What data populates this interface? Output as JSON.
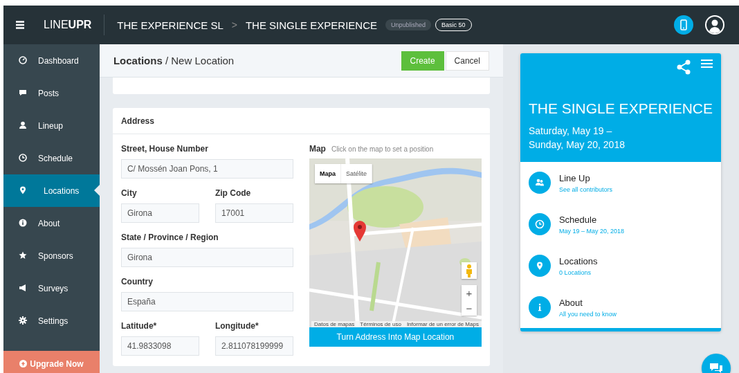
{
  "topbar": {
    "logo_light": "LINE",
    "logo_bold": "UPR",
    "breadcrumb": [
      "THE EXPERIENCE SL",
      "THE SINGLE EXPERIENCE"
    ],
    "separator": ">",
    "badges": [
      {
        "label": "Unpublished",
        "kind": "status"
      },
      {
        "label": "Basic 50",
        "kind": "plan"
      }
    ]
  },
  "sidebar": {
    "items": [
      {
        "label": "Dashboard",
        "selected": false
      },
      {
        "label": "Posts",
        "selected": false
      },
      {
        "label": "Lineup",
        "selected": false
      },
      {
        "label": "Schedule",
        "selected": false
      },
      {
        "label": "Locations",
        "selected": true
      },
      {
        "label": "About",
        "selected": false
      },
      {
        "label": "Sponsors",
        "selected": false
      },
      {
        "label": "Surveys",
        "selected": false
      },
      {
        "label": "Settings",
        "selected": false
      }
    ],
    "upgrade": "Upgrade Now"
  },
  "header": {
    "section": "Locations",
    "separator": "/",
    "page": "New Location",
    "buttons": [
      {
        "label": "Create",
        "kind": "primary"
      },
      {
        "label": "Cancel",
        "kind": "default"
      }
    ]
  },
  "address": {
    "title": "Address",
    "fields": [
      {
        "label": "Street, House Number",
        "value": "C/ Mossén Joan Pons, 1",
        "kind": "wide"
      },
      {
        "label": "City",
        "value": "Girona",
        "kind": "narrow"
      },
      {
        "label": "Zip Code",
        "value": "17001",
        "kind": "narrow"
      },
      {
        "label": "State / Province / Region",
        "value": "Girona",
        "kind": "wide"
      },
      {
        "label": "Country",
        "value": "España",
        "kind": "wide"
      },
      {
        "label": "Latitude*",
        "value": "41.9833098",
        "kind": "narrow"
      },
      {
        "label": "Longitude*",
        "value": "2.811078199999",
        "kind": "narrow"
      }
    ],
    "map": {
      "label": "Map",
      "hint": "Click on the map to set a position",
      "types": [
        {
          "label": "Mapa",
          "selected": true
        },
        {
          "label": "Satélite",
          "selected": false
        }
      ],
      "zoom": [
        "+",
        "−"
      ],
      "footer": [
        "Datos de mapas",
        "Términos de uso",
        "Informar de un error de Maps"
      ],
      "button": "Turn Address Into Map Location"
    }
  },
  "preview": {
    "title": "THE SINGLE EXPERIENCE",
    "dates": [
      "Saturday, May 19 –",
      "Sunday, May 20, 2018"
    ],
    "items": [
      {
        "title": "Line Up",
        "subtitle": "See all contributors"
      },
      {
        "title": "Schedule",
        "subtitle": "May 19 – May 20, 2018"
      },
      {
        "title": "Locations",
        "subtitle": "0 Locations"
      },
      {
        "title": "About",
        "subtitle": "All you need to know"
      }
    ]
  }
}
